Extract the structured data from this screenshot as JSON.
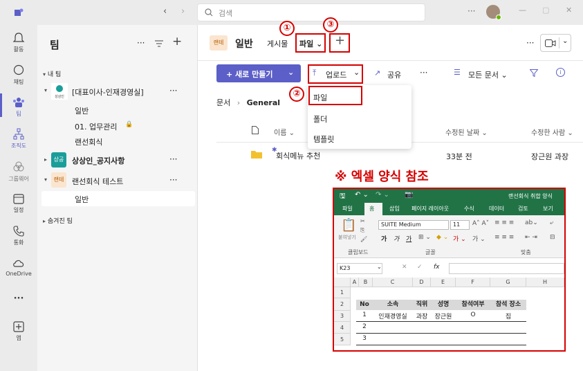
{
  "search": {
    "placeholder": "검색"
  },
  "rail": [
    {
      "label": "활동",
      "icon": "bell-icon"
    },
    {
      "label": "채팅",
      "icon": "chat-icon"
    },
    {
      "label": "팀",
      "icon": "teams-icon"
    },
    {
      "label": "조직도",
      "icon": "org-chart-icon"
    },
    {
      "label": "그룹웨어",
      "icon": "groupware-icon"
    },
    {
      "label": "일정",
      "icon": "calendar-icon"
    },
    {
      "label": "통화",
      "icon": "phone-icon"
    },
    {
      "label": "OneDrive",
      "icon": "onedrive-icon"
    },
    {
      "label": "...",
      "icon": "more-icon"
    },
    {
      "label": "앱",
      "icon": "apps-icon"
    }
  ],
  "teams": {
    "title": "팀",
    "my_teams": "내 팀",
    "team1": {
      "name": "[대표이사-인재경영실]",
      "logo_text": "성상인",
      "channels": [
        "일반",
        "01. 업무관리",
        "랜선회식"
      ]
    },
    "team2": {
      "name": "상상인_공지사항",
      "badge": "상공"
    },
    "team3": {
      "name": "랜선회식 테스트",
      "badge": "랜테",
      "channel": "일반"
    },
    "hidden": "숨겨진 팀"
  },
  "channel": {
    "badge": "랜테",
    "name": "일반",
    "tab_posts": "게시물",
    "tab_files": "파일",
    "tab_files_caret": "⌄",
    "add_tab": "+"
  },
  "toolbar": {
    "new": "+ 새로 만들기",
    "upload": "업로드",
    "share": "공유",
    "more": "···",
    "all_docs": "모든 문서"
  },
  "breadcrumb": {
    "root": "문서",
    "current": "General"
  },
  "dropdown": {
    "items": [
      "파일",
      "폴더",
      "템플릿"
    ]
  },
  "table": {
    "col_name": "이름",
    "col_modified": "수정된 날짜",
    "col_modified_by": "수정한 사람",
    "row_name": "회식메뉴 추천",
    "row_modified": "33분 전",
    "row_by": "장근원 과장"
  },
  "annotations": {
    "one": "①",
    "two": "②",
    "three": "③",
    "note": "※ 엑셀 양식 참조"
  },
  "excel": {
    "title": "랜선회식 취합 양식",
    "tabs": [
      "파일",
      "홈",
      "삽입",
      "페이지 레이아웃",
      "수식",
      "데이터",
      "검토",
      "보기"
    ],
    "font": "SUITE Medium",
    "size": "11",
    "paste": "붙여넣기",
    "groups": [
      "클립보드",
      "글꼴",
      "맞춤"
    ],
    "cellref": "K23",
    "fx": "fx",
    "cols": [
      "A",
      "B",
      "C",
      "D",
      "E",
      "F",
      "G",
      "H"
    ],
    "rows": [
      "1",
      "2",
      "3",
      "4",
      "5"
    ],
    "headers": [
      "No",
      "소속",
      "직위",
      "성명",
      "참석여부",
      "참석 장소"
    ],
    "data": [
      [
        "1",
        "인재경영실",
        "과장",
        "장근원",
        "O",
        "집"
      ],
      [
        "2",
        "",
        "",
        "",
        "",
        ""
      ],
      [
        "3",
        "",
        "",
        "",
        "",
        ""
      ]
    ]
  },
  "colors": {
    "accent": "#5b5fc7",
    "annotation": "#d50000",
    "excel": "#217346"
  }
}
